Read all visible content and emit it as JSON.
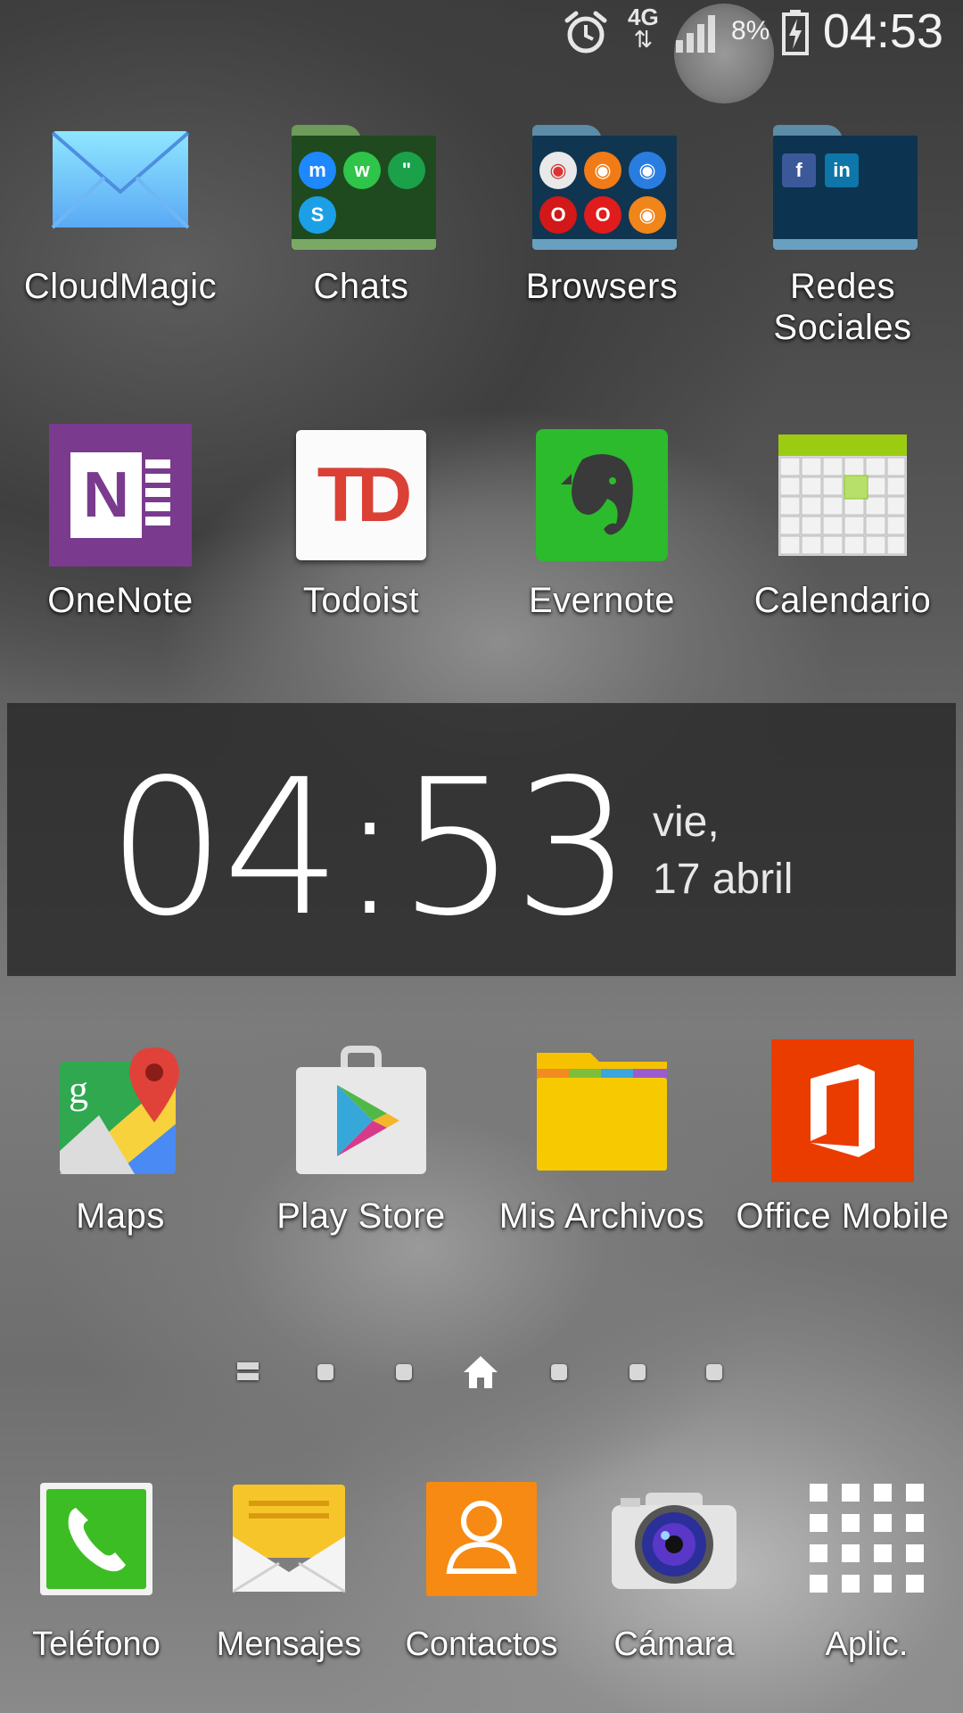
{
  "status_bar": {
    "network": "4G",
    "battery_percent": "8%",
    "time": "04:53"
  },
  "home_grid": {
    "row1": [
      {
        "label": "CloudMagic",
        "icon": "mail-envelope-icon"
      },
      {
        "label": "Chats",
        "icon": "folder-icon"
      },
      {
        "label": "Browsers",
        "icon": "folder-icon"
      },
      {
        "label": "Redes Sociales",
        "line1": "Redes",
        "line2": "Sociales",
        "icon": "folder-icon"
      }
    ],
    "row2": [
      {
        "label": "OneNote",
        "icon": "onenote-icon",
        "glyph": "N"
      },
      {
        "label": "Todoist",
        "icon": "todoist-icon",
        "glyph": "TD"
      },
      {
        "label": "Evernote",
        "icon": "evernote-elephant-icon"
      },
      {
        "label": "Calendario",
        "icon": "calendar-grid-icon"
      }
    ],
    "row3": [
      {
        "label": "Maps",
        "icon": "google-maps-icon",
        "glyph": "g"
      },
      {
        "label": "Play Store",
        "icon": "play-store-bag-icon"
      },
      {
        "label": "Mis Archivos",
        "icon": "files-folder-icon"
      },
      {
        "label": "Office Mobile",
        "icon": "office-logo-icon"
      }
    ]
  },
  "folders": {
    "chats": {
      "tile_glyphs": [
        "m",
        "w",
        "\"",
        "S"
      ]
    },
    "browsers": {
      "tile_glyphs": [
        "◉",
        "◉",
        "◉",
        "O",
        "O",
        "◉"
      ]
    },
    "social": {
      "tile_glyphs": [
        "f",
        "in"
      ]
    }
  },
  "clock_widget": {
    "time": "04:53",
    "day": "vie,",
    "date": "17 abril"
  },
  "pager": {
    "pages": 7,
    "current_index": 3
  },
  "dock": [
    {
      "label": "Teléfono",
      "icon": "phone-handset-icon"
    },
    {
      "label": "Mensajes",
      "icon": "message-envelope-icon"
    },
    {
      "label": "Contactos",
      "icon": "contact-person-icon"
    },
    {
      "label": "Cámara",
      "icon": "camera-icon"
    },
    {
      "label": "Aplic.",
      "icon": "app-grid-icon"
    }
  ],
  "colors": {
    "onenote": "#7a3b8e",
    "todoist_red": "#db4035",
    "evernote_green": "#2cbb2c",
    "office_red": "#eb3c00",
    "play_white": "#e8e8e8",
    "files_yellow": "#f6c200",
    "phone_green": "#3cbd24",
    "contacts_orange": "#f68a12"
  }
}
